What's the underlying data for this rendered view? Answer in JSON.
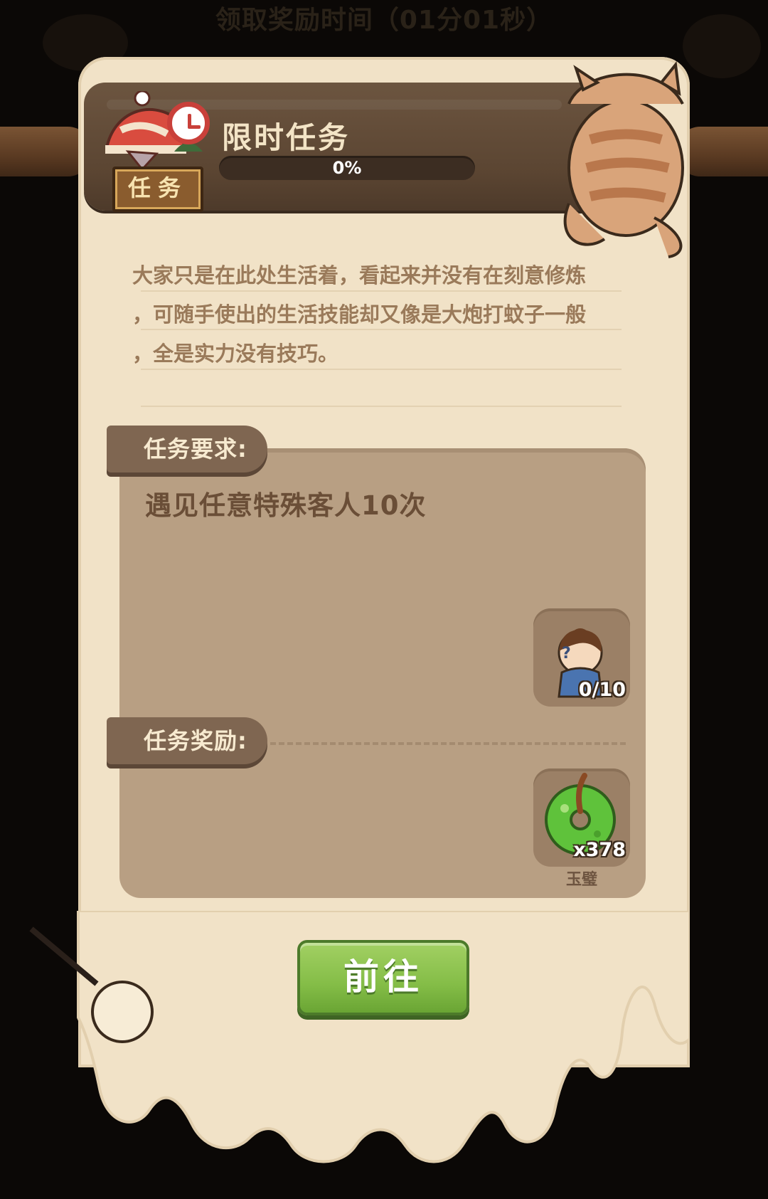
{
  "top_bar": {
    "title": "领取奖励时间（01分01秒）"
  },
  "header": {
    "badge": "任务",
    "title": "限时任务",
    "progress": {
      "value": 0,
      "label": "0%"
    }
  },
  "description": {
    "lines": [
      "大家只是在此处生活着，看起来并没有在刻意修炼",
      "，可随手使出的生活技能却又像是大炮打蚊子一般",
      "，全是实力没有技巧。"
    ]
  },
  "requirement": {
    "heading": "任务要求:",
    "text": "遇见任意特殊客人10次",
    "item": {
      "icon": "special-guest-icon",
      "count": "0/10"
    }
  },
  "reward": {
    "heading": "任务奖励:",
    "item": {
      "icon": "jade-bi-icon",
      "count": "x378",
      "name": "玉璧"
    }
  },
  "actions": {
    "go_label": "前往"
  },
  "colors": {
    "scroll": "#f1e2c7",
    "panel": "#b89f83",
    "header_plank": "#5b4532",
    "button_green": "#84bd47",
    "clock_red": "#c9403a",
    "jade_green": "#5fc23b"
  }
}
